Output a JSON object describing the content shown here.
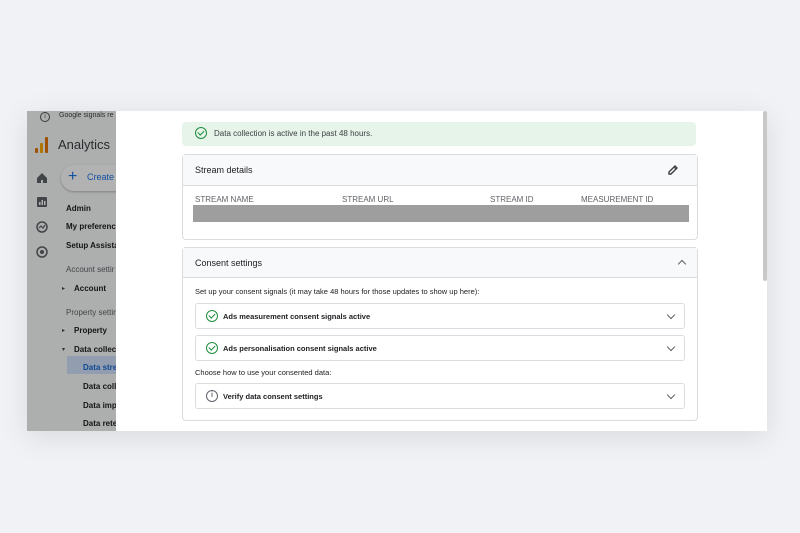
{
  "background_app": {
    "banner_text": "Google signals re",
    "app_name": "Analytics",
    "create_label": "Create",
    "nav": {
      "admin": "Admin",
      "my_preferences": "My preferenc",
      "setup_assistant": "Setup Assistan",
      "account_settings": "Account settir",
      "account": "Account",
      "property_settings": "Property settir",
      "property": "Property",
      "data_collection": "Data collect",
      "data_streams": "Data strea",
      "data_collection_sub": "Data colle",
      "data_import": "Data impo",
      "data_retention": "Data reter"
    }
  },
  "alert": {
    "text": "Data collection is active in the past 48 hours."
  },
  "stream_details": {
    "title": "Stream details",
    "columns": [
      "STREAM NAME",
      "STREAM URL",
      "STREAM ID",
      "MEASUREMENT ID"
    ]
  },
  "consent_settings": {
    "title": "Consent settings",
    "intro": "Set up your consent signals (it may take 48 hours for those updates to show up here):",
    "items": [
      {
        "label": "Ads measurement consent signals active"
      },
      {
        "label": "Ads personalisation consent signals active"
      }
    ],
    "choose_text": "Choose how to use your consented data:",
    "verify_label": "Verify data consent settings"
  },
  "colors": {
    "accent": "#1a73e8",
    "success": "#1e8e3e",
    "alert_bg": "#e6f4ea"
  },
  "icons": [
    "info-icon",
    "analytics-logo",
    "home-icon",
    "reports-icon",
    "explore-icon",
    "advertising-icon",
    "check-circle-icon",
    "edit-icon",
    "chevron-up-icon",
    "chevron-down-icon"
  ]
}
